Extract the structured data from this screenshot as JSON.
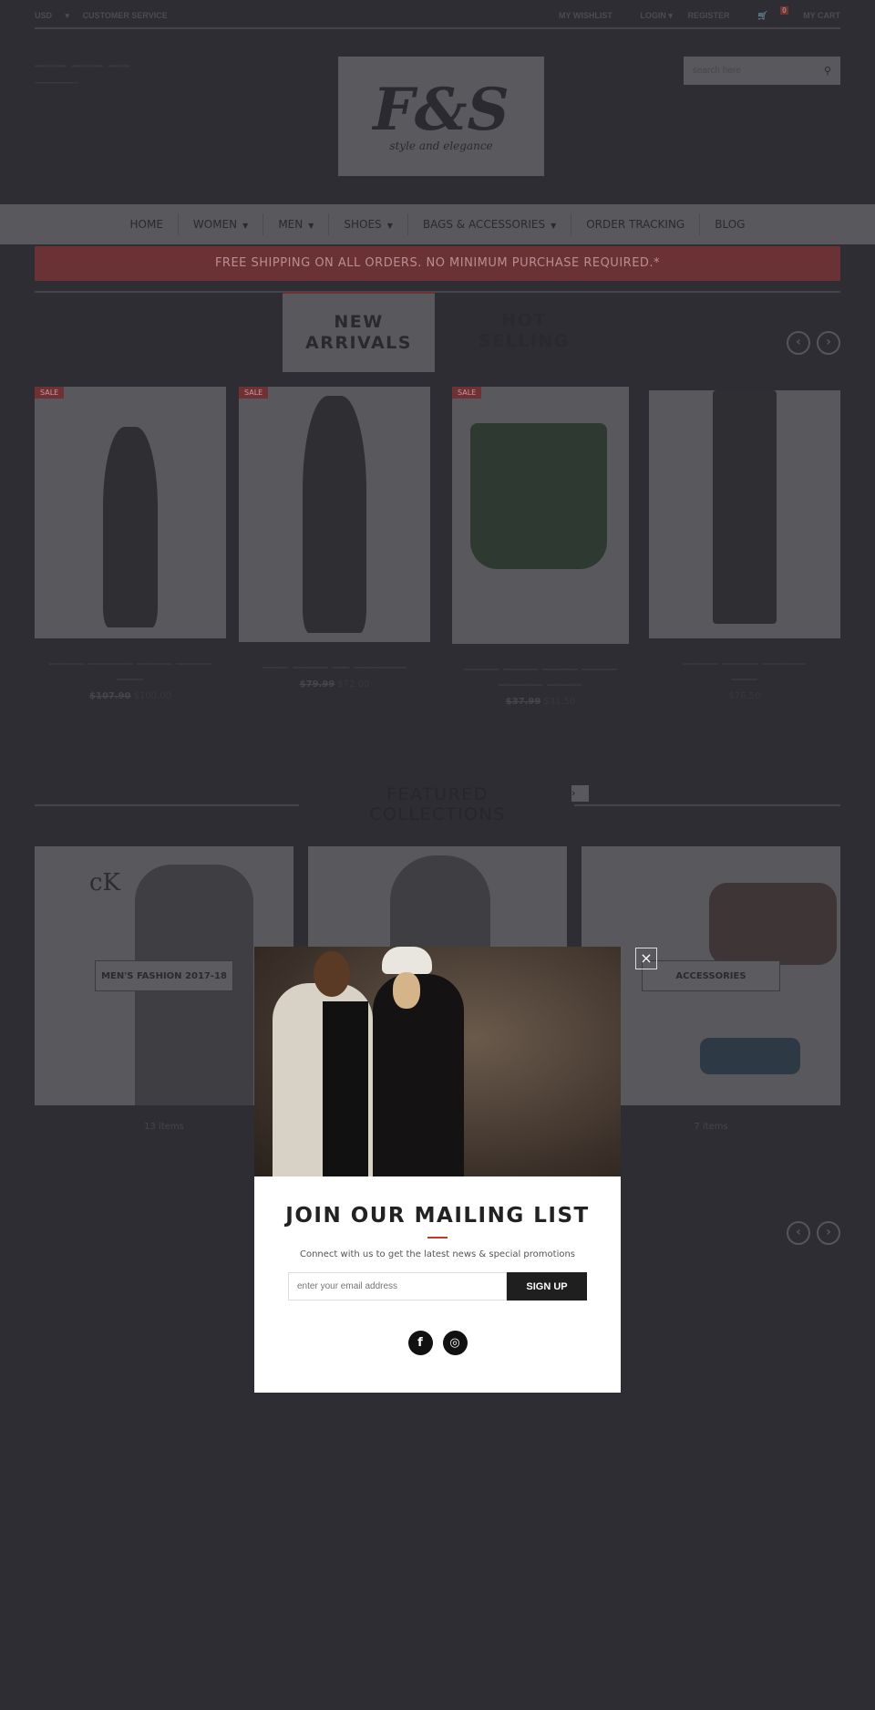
{
  "topbar": {
    "currency": "USD",
    "customer_service": "CUSTOMER SERVICE",
    "wishlist": "MY WISHLIST",
    "login": "LOGIN",
    "register": "REGISTER",
    "cart_count": "0",
    "cart": "MY CART"
  },
  "header": {
    "logo_text": "F&S",
    "logo_tagline": "style and elegance",
    "search_placeholder": "search here"
  },
  "nav": [
    {
      "label": "HOME",
      "dropdown": false
    },
    {
      "label": "WOMEN",
      "dropdown": true
    },
    {
      "label": "MEN",
      "dropdown": true
    },
    {
      "label": "SHOES",
      "dropdown": true
    },
    {
      "label": "BAGS & ACCESSORIES",
      "dropdown": true
    },
    {
      "label": "ORDER TRACKING",
      "dropdown": false
    },
    {
      "label": "BLOG",
      "dropdown": false
    }
  ],
  "banner": "FREE SHIPPING ON ALL ORDERS. NO MINIMUM PURCHASE REQUIRED.*",
  "tabs": {
    "new": "NEW ARRIVALS",
    "hot": "HOT SELLING"
  },
  "products": [
    {
      "sale": "SALE",
      "old_price": "$107.90",
      "price": "$100.00"
    },
    {
      "sale": "SALE",
      "old_price": "$79.99",
      "price": "$72.00"
    },
    {
      "sale": "SALE",
      "old_price": "$37.99",
      "price": "$31.50"
    },
    {
      "sale": "",
      "old_price": "",
      "price": "$76.50"
    }
  ],
  "featured": {
    "title": "FEATURED COLLECTIONS",
    "collections": [
      {
        "label": "MEN'S FASHION 2017-18",
        "count": "13 items",
        "logo": "cK"
      },
      {
        "label": "",
        "count": ""
      },
      {
        "label": "ACCESSORIES",
        "count": "7 items"
      }
    ]
  },
  "modal": {
    "title": "JOIN OUR MAILING LIST",
    "subtitle": "Connect with us to get the latest news & special promotions",
    "email_placeholder": "enter your email address",
    "signup": "SIGN UP",
    "close": "×",
    "social": [
      "f",
      "◎"
    ]
  },
  "colors": {
    "accent": "#c0392b",
    "overlay_bg": "#2e2d33"
  }
}
